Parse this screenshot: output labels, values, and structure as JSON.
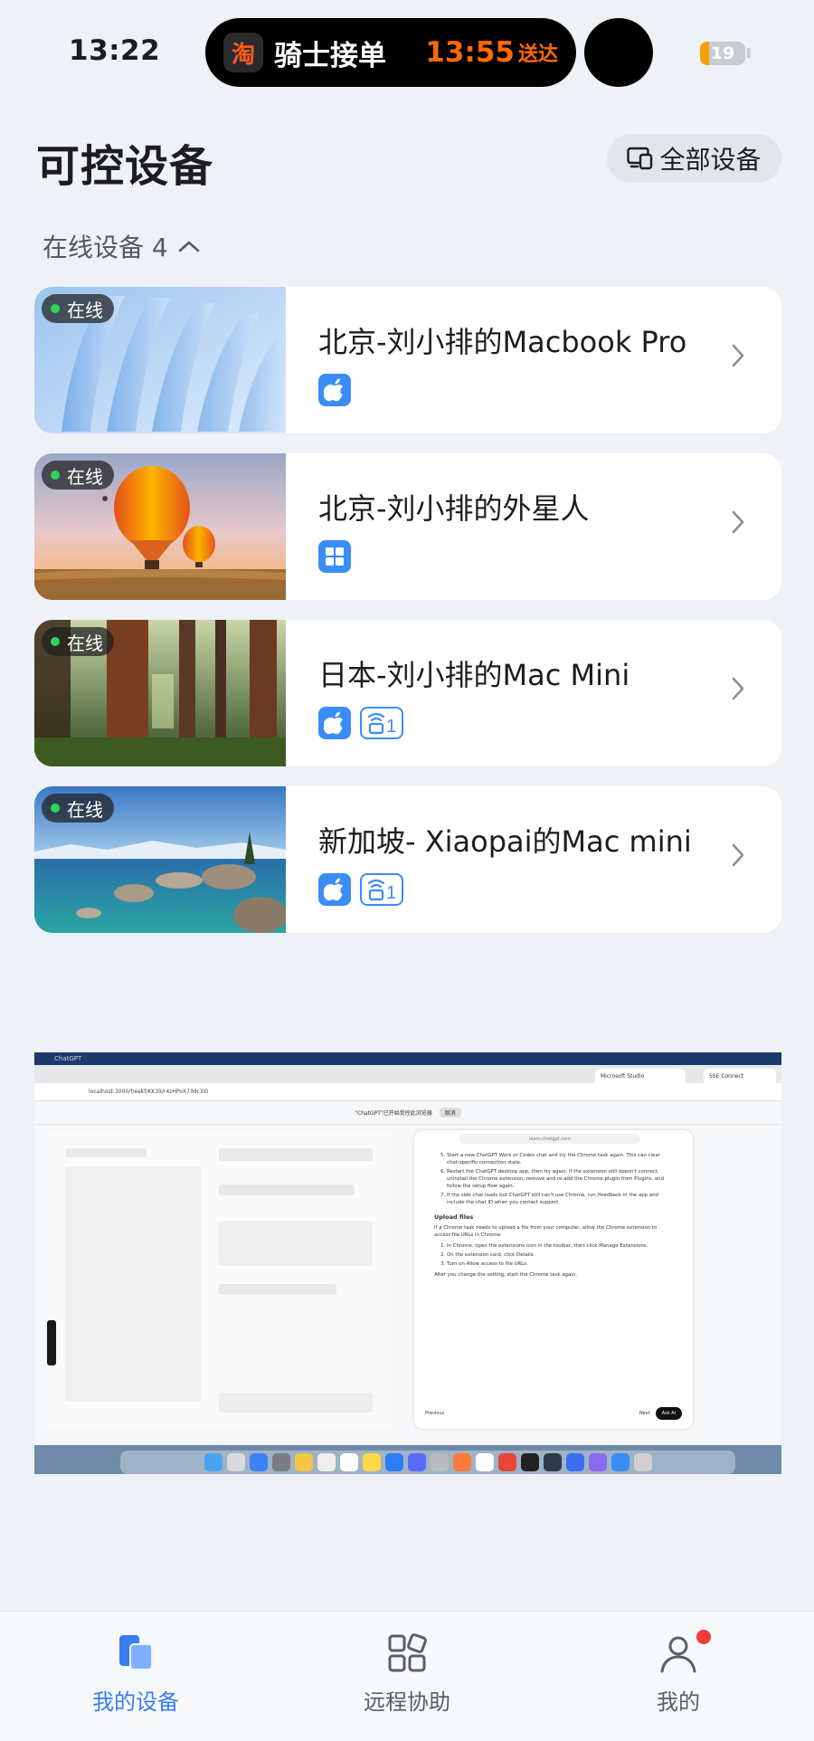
{
  "status_bar": {
    "time": "13:22",
    "live_activity": {
      "app_icon_char": "淘",
      "title": "骑士接单",
      "eta_time": "13:55",
      "eta_suffix": "送达"
    },
    "battery_level": "19",
    "battery_percent": 19
  },
  "header": {
    "title": "可控设备",
    "all_devices_button": "全部设备"
  },
  "section": {
    "label": "在线设备 4"
  },
  "devices": [
    {
      "status": "在线",
      "name": "北京-刘小排的Macbook Pro",
      "os_icon": "apple-icon",
      "has_cast_tag": false,
      "cast_tag_text": ""
    },
    {
      "status": "在线",
      "name": "北京-刘小排的外星人",
      "os_icon": "windows-icon",
      "has_cast_tag": false,
      "cast_tag_text": ""
    },
    {
      "status": "在线",
      "name": "日本-刘小排的Mac Mini",
      "os_icon": "apple-icon",
      "has_cast_tag": true,
      "cast_tag_text": "1"
    },
    {
      "status": "在线",
      "name": "新加坡- Xiaopai的Mac mini",
      "os_icon": "apple-icon",
      "has_cast_tag": true,
      "cast_tag_text": "1"
    }
  ],
  "preview": {
    "menubar_app": "ChatGPT",
    "tab_1": "Microsoft Studio",
    "tab_2": "SSE Connect",
    "address": "localhost:3000/f/eekf/KK39/r4zHPoX73dc3i0",
    "notice": "\"ChatGPT\"已开始受控此浏览器",
    "notice_button": "取消",
    "doc_search": "learn.chatgpt.com",
    "doc_items": [
      "Start a new ChatGPT Work or Codex chat and try the Chrome task again. This can clear chat-specific connection state.",
      "Restart the ChatGPT desktop app, then try again. If the extension still doesn't connect, uninstall the Chrome extension, remove and re-add the Chrome plugin from Plugins, and follow the setup flow again.",
      "If the side chat loads but ChatGPT still can't use Chrome, run /feedback in the app and include the chat ID when you contact support."
    ],
    "doc_heading": "Upload files",
    "doc_paragraph": "If a Chrome task needs to upload a file from your computer, allow the Chrome extension to access file URLs in Chrome:",
    "doc_steps": [
      "In Chrome, open the extensions icon in the toolbar, then click Manage Extensions.",
      "On the extension card, click Details.",
      "Turn on Allow access to file URLs."
    ],
    "doc_after": "After you change the setting, start the Chrome task again.",
    "footer_prev": "Previous",
    "footer_next": "Next",
    "footer_ask": "Ask AI"
  },
  "bottom_nav": [
    {
      "label": "我的设备",
      "active": true
    },
    {
      "label": "远程协助",
      "active": false
    },
    {
      "label": "我的",
      "active": false,
      "badge": true
    }
  ],
  "colors": {
    "accent": "#3a7cf0",
    "os_tag": "#3a8cf7",
    "online": "#2fd35a",
    "eta": "#ff6a00",
    "badge": "#f23a3a"
  }
}
